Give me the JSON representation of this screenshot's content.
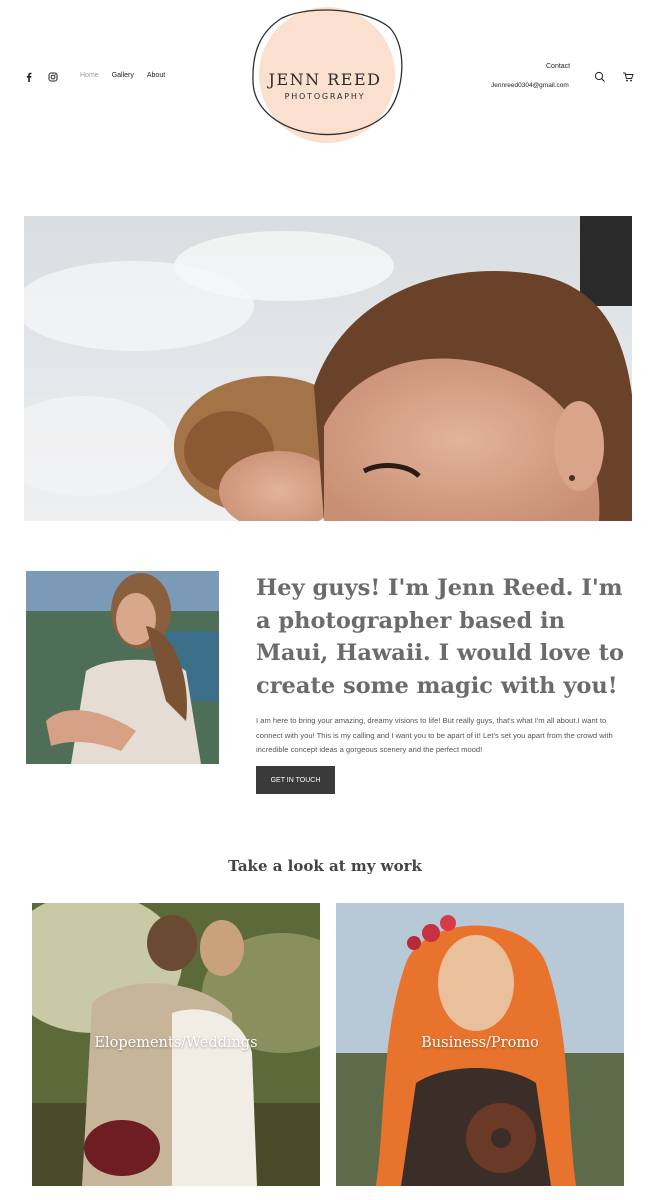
{
  "header": {
    "social": [
      {
        "icon": "facebook-icon"
      },
      {
        "icon": "instagram-icon"
      }
    ],
    "nav": [
      "Home",
      "Gallery",
      "About"
    ],
    "active_nav": "Home",
    "logo": {
      "title": "JENN REED",
      "subtitle": "PHOTOGRAPHY",
      "circle_color": "#fbe0d0"
    },
    "contact_label": "Contact",
    "email": "Jennreed0304@gmail.com",
    "icons": [
      "search-icon",
      "cart-icon"
    ]
  },
  "about": {
    "heading": "Hey guys! I'm Jenn Reed. I'm a photographer based in Maui, Hawaii. I would love to create some magic with you!",
    "body": "I am here to bring your amazing, dreamy visions to life! But really guys, that's what I'm all about.I want to connect with you! This is my calling and I want you to be apart of it! Let's set you apart from the crowd with incredible concept ideas a gorgeous scenery and the perfect mood!",
    "cta_label": "GET IN TOUCH"
  },
  "work": {
    "title": "Take a look at my work",
    "cards": [
      {
        "label": "Elopements/Weddings"
      },
      {
        "label": "Business/Promo"
      }
    ]
  },
  "colors": {
    "button_bg": "#3a3a3a",
    "heading_text": "#6b6b6b"
  }
}
